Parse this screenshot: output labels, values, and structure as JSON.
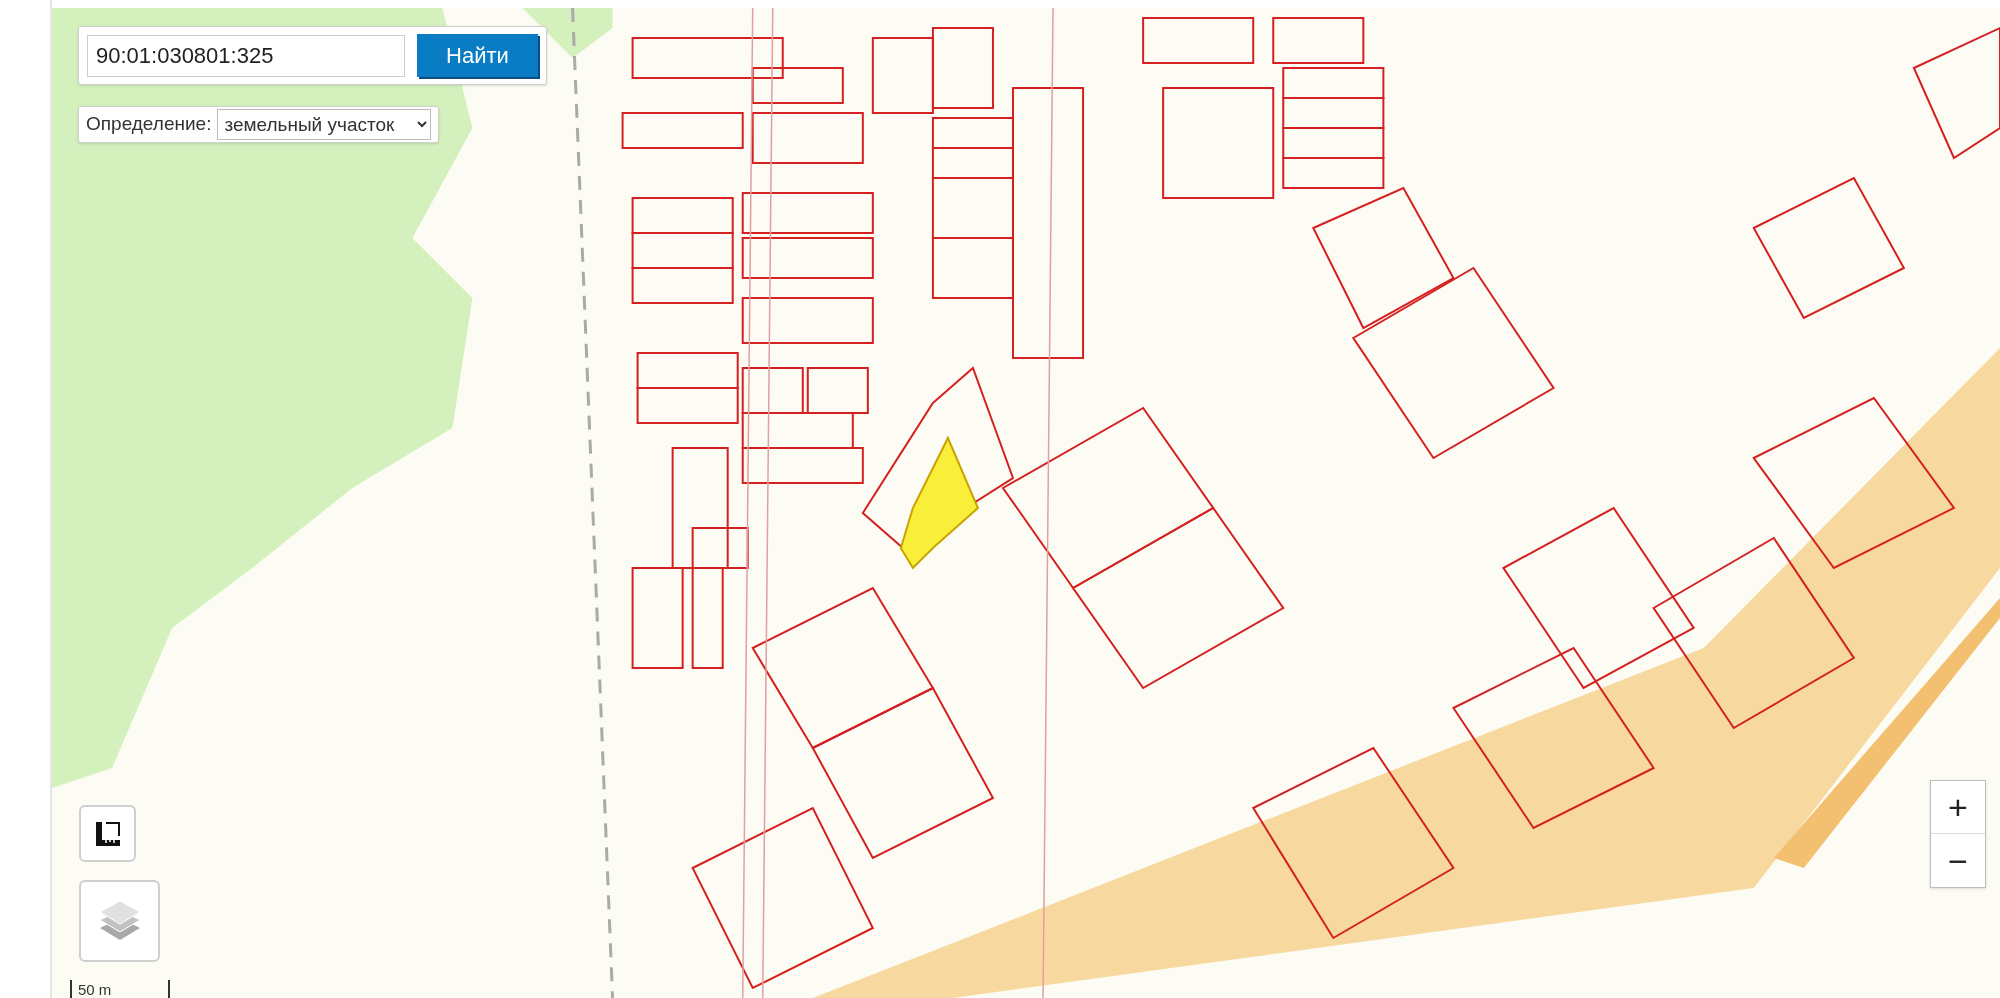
{
  "search": {
    "value": "90:01:030801:325",
    "button": "Найти"
  },
  "definition": {
    "label": "Определение:",
    "value": "земельный участок"
  },
  "zoom": {
    "in": "+",
    "out": "−"
  },
  "scale": "50 m"
}
